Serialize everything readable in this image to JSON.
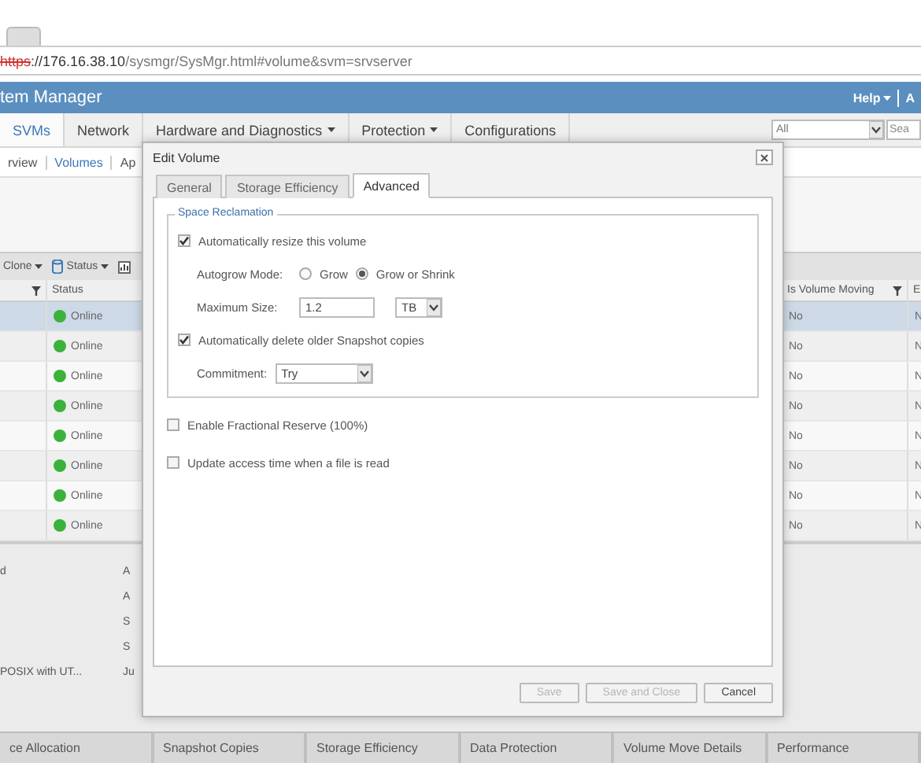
{
  "browser": {
    "url_scheme": "https",
    "url_host": "://176.16.38.10",
    "url_path": "/sysmgr/SysMgr.html#volume&svm=srvserver"
  },
  "header": {
    "title": "tem Manager",
    "help": "Help",
    "account": "A"
  },
  "nav": [
    {
      "label": "SVMs",
      "selected": true,
      "menu": false
    },
    {
      "label": "Network",
      "selected": false,
      "menu": false
    },
    {
      "label": "Hardware and Diagnostics",
      "selected": false,
      "menu": true
    },
    {
      "label": "Protection",
      "selected": false,
      "menu": true
    },
    {
      "label": "Configurations",
      "selected": false,
      "menu": false
    }
  ],
  "filter": {
    "value": "All"
  },
  "search": {
    "placeholder": "Sea"
  },
  "subnav": [
    {
      "label": "rview",
      "selected": false
    },
    {
      "label": "Volumes",
      "selected": true
    },
    {
      "label": "Ap",
      "selected": false
    }
  ],
  "toolbar": [
    {
      "label": "Clone",
      "kind": "plain"
    },
    {
      "label": "Status",
      "kind": "disk"
    }
  ],
  "table": {
    "columns": [
      "Status",
      "Is Volume Moving",
      "E"
    ],
    "rows": [
      {
        "status": "Online",
        "moving": "No",
        "column_3": "N",
        "selected": true
      },
      {
        "status": "Online",
        "moving": "No",
        "column_3": "N",
        "selected": false
      },
      {
        "status": "Online",
        "moving": "No",
        "column_3": "N",
        "selected": false
      },
      {
        "status": "Online",
        "moving": "No",
        "column_3": "N",
        "selected": false
      },
      {
        "status": "Online",
        "moving": "No",
        "column_3": "N",
        "selected": false
      },
      {
        "status": "Online",
        "moving": "No",
        "column_3": "N",
        "selected": false
      },
      {
        "status": "Online",
        "moving": "No",
        "column_3": "N",
        "selected": false
      },
      {
        "status": "Online",
        "moving": "No",
        "column_3": "N",
        "selected": false
      }
    ]
  },
  "details": [
    {
      "value": "d",
      "label": "A"
    },
    {
      "label": "A"
    },
    {
      "label": "S"
    },
    {
      "label": "S"
    },
    {
      "value": "POSIX with UT...",
      "label": "Ju"
    }
  ],
  "bottom_tabs": [
    "ce Allocation",
    "Snapshot Copies",
    "Storage Efficiency",
    "Data Protection",
    "Volume Move Details",
    "Performance"
  ],
  "dialog": {
    "title": "Edit Volume",
    "tabs": [
      {
        "label": "General",
        "selected": false
      },
      {
        "label": "Storage Efficiency",
        "selected": false
      },
      {
        "label": "Advanced",
        "selected": true
      }
    ],
    "group_title": "Space Reclamation",
    "autoresize": {
      "label": "Automatically resize this volume",
      "checked": true
    },
    "autogrow": {
      "label": "Autogrow Mode:",
      "options": [
        {
          "label": "Grow",
          "selected": false
        },
        {
          "label": "Grow or Shrink",
          "selected": true
        }
      ]
    },
    "max_size": {
      "label": "Maximum Size:",
      "value": "1.2",
      "unit": "TB"
    },
    "autodelete": {
      "label": "Automatically delete older Snapshot copies",
      "checked": true
    },
    "commitment": {
      "label": "Commitment:",
      "value": "Try"
    },
    "options": [
      {
        "label": "Enable Fractional Reserve (100%)",
        "checked": false
      },
      {
        "label": "Update access time when a file is read",
        "checked": false
      }
    ],
    "buttons": [
      {
        "label": "Save",
        "disabled": true
      },
      {
        "label": "Save and Close",
        "disabled": true
      },
      {
        "label": "Cancel",
        "disabled": false
      }
    ]
  }
}
